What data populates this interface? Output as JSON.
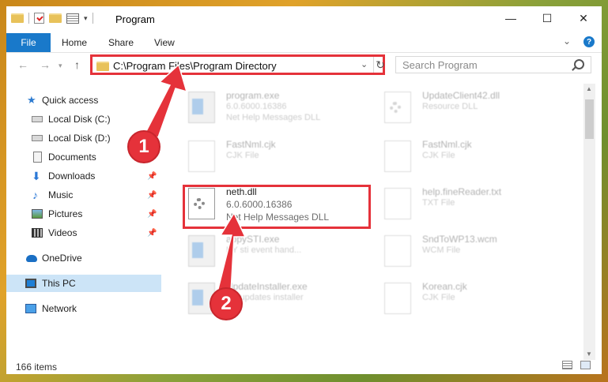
{
  "window": {
    "title": "Program",
    "controls": {
      "minimize": "—",
      "maximize": "☐",
      "close": "✕"
    }
  },
  "ribbon": {
    "tabs": [
      "File",
      "Home",
      "Share",
      "View"
    ]
  },
  "address_bar": {
    "path": "C:\\Program Files\\Program Directory"
  },
  "search": {
    "placeholder": "Search Program"
  },
  "sidebar": {
    "items": [
      {
        "label": "Quick access",
        "icon": "star-icon"
      },
      {
        "label": "Local Disk (C:)",
        "icon": "disk-icon"
      },
      {
        "label": "Local Disk (D:)",
        "icon": "disk-icon"
      },
      {
        "label": "Documents",
        "icon": "documents-icon"
      },
      {
        "label": "Downloads",
        "icon": "download-icon",
        "pinned": true
      },
      {
        "label": "Music",
        "icon": "music-icon",
        "pinned": true
      },
      {
        "label": "Pictures",
        "icon": "pictures-icon",
        "pinned": true
      },
      {
        "label": "Videos",
        "icon": "videos-icon",
        "pinned": true
      },
      {
        "label": "OneDrive",
        "icon": "cloud-icon"
      },
      {
        "label": "This PC",
        "icon": "pc-icon",
        "selected": true
      },
      {
        "label": "Network",
        "icon": "network-icon"
      }
    ]
  },
  "files": [
    {
      "name": "program.exe",
      "line2": "6.0.6000.16386",
      "line3": "Net Help Messages DLL",
      "icon": "exe-icon"
    },
    {
      "name": "UpdateClient42.dll",
      "line2": "Resource DLL",
      "icon": "dll-icon"
    },
    {
      "name": "FastNml.cjk",
      "line2": "CJK File",
      "icon": "file-icon"
    },
    {
      "name": "FastNml.cjk",
      "line2": "CJK File",
      "icon": "file-icon"
    },
    {
      "name": "neth.dll",
      "line2": "6.0.6000.16386",
      "line3": "Net Help Messages DLL",
      "icon": "dll-icon"
    },
    {
      "name": "help.fineReader.txt",
      "line2": "TXT File",
      "icon": "file-icon"
    },
    {
      "name": "appySTI.exe",
      "line2": "KY sti event hand...",
      "icon": "exe-icon"
    },
    {
      "name": "SndToWP13.wcm",
      "line2": "WCM File",
      "icon": "file-icon"
    },
    {
      "name": "UpdateInstaller.exe",
      "line2": "KY updates installer",
      "icon": "exe-icon"
    },
    {
      "name": "Korean.cjk",
      "line2": "CJK File",
      "icon": "file-icon"
    }
  ],
  "status": {
    "item_count": "166 items"
  },
  "callouts": [
    "1",
    "2"
  ],
  "colors": {
    "accent": "#1979ca",
    "highlight": "#e5323a",
    "selected": "#cce4f7"
  }
}
